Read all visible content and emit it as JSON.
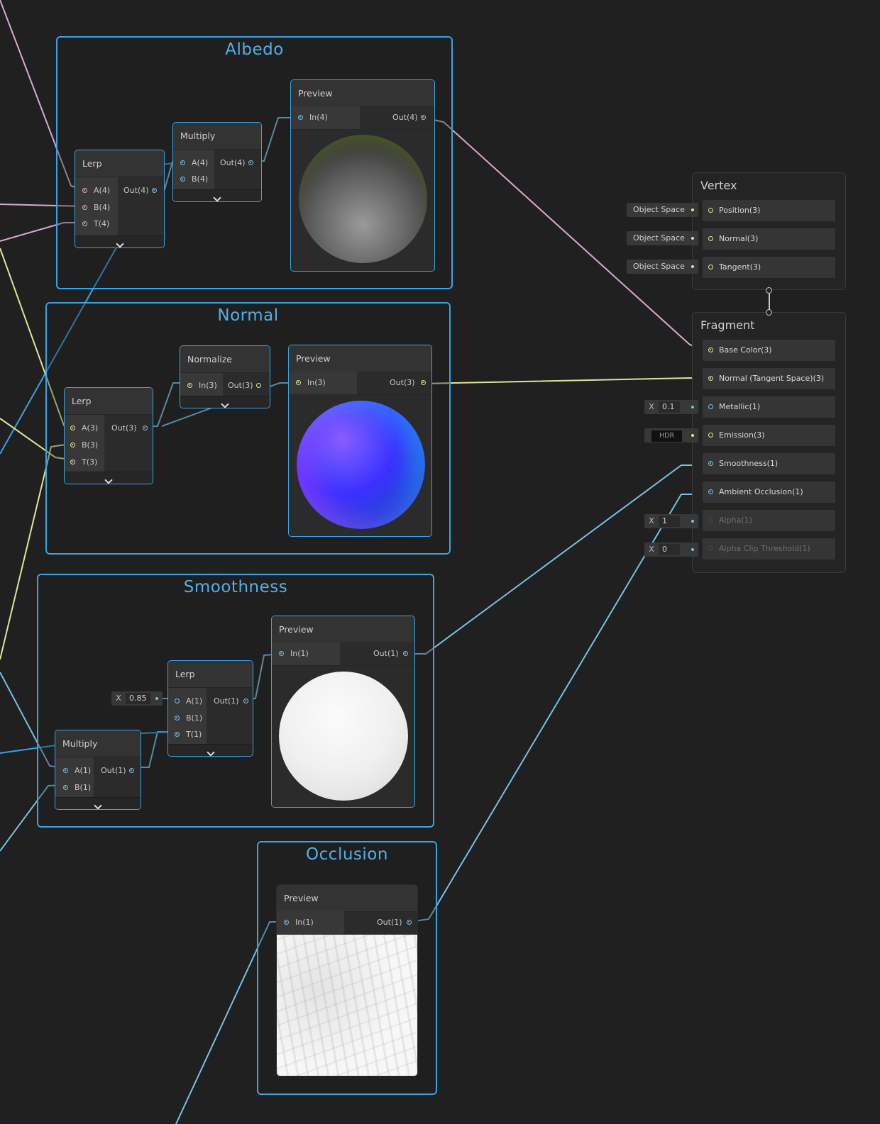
{
  "groups": {
    "albedo": "Albedo",
    "normal": "Normal",
    "smoothness": "Smoothness",
    "occlusion": "Occlusion"
  },
  "albedo": {
    "lerp": {
      "title": "Lerp",
      "in": [
        "A(4)",
        "B(4)",
        "T(4)"
      ],
      "out": "Out(4)"
    },
    "multiply": {
      "title": "Multiply",
      "in": [
        "A(4)",
        "B(4)"
      ],
      "out": "Out(4)"
    },
    "preview": {
      "title": "Preview",
      "in": "In(4)",
      "out": "Out(4)"
    }
  },
  "normal": {
    "lerp": {
      "title": "Lerp",
      "in": [
        "A(3)",
        "B(3)",
        "T(3)"
      ],
      "out": "Out(3)"
    },
    "normalize": {
      "title": "Normalize",
      "in": "In(3)",
      "out": "Out(3)"
    },
    "preview": {
      "title": "Preview",
      "in": "In(3)",
      "out": "Out(3)"
    }
  },
  "smoothness": {
    "lerp": {
      "title": "Lerp",
      "in": [
        "A(1)",
        "B(1)",
        "T(1)"
      ],
      "out": "Out(1)"
    },
    "multiply": {
      "title": "Multiply",
      "in": [
        "A(1)",
        "B(1)"
      ],
      "out": "Out(1)"
    },
    "preview": {
      "title": "Preview",
      "in": "In(1)",
      "out": "Out(1)"
    },
    "a_value": {
      "x": "X",
      "value": "0.85"
    }
  },
  "occlusion": {
    "preview": {
      "title": "Preview",
      "in": "In(1)",
      "out": "Out(1)"
    }
  },
  "vertex": {
    "title": "Vertex",
    "slots": [
      "Position(3)",
      "Normal(3)",
      "Tangent(3)"
    ],
    "space_label": "Object Space"
  },
  "fragment": {
    "title": "Fragment",
    "slots": [
      "Base Color(3)",
      "Normal (Tangent Space)(3)",
      "Metallic(1)",
      "Emission(3)",
      "Smoothness(1)",
      "Ambient Occlusion(1)",
      "Alpha(1)",
      "Alpha Clip Threshold(1)"
    ],
    "metallic": {
      "x": "X",
      "value": "0.1"
    },
    "emission": "HDR",
    "alpha": {
      "x": "X",
      "value": "1"
    },
    "alpha_clip": {
      "x": "X",
      "value": "0"
    }
  },
  "colors": {
    "group_border": "#3aa3e3",
    "vector4_wire": "#d8a9d2",
    "vector3_wire": "#e0e398",
    "vector1_wire": "#78c0e6"
  }
}
